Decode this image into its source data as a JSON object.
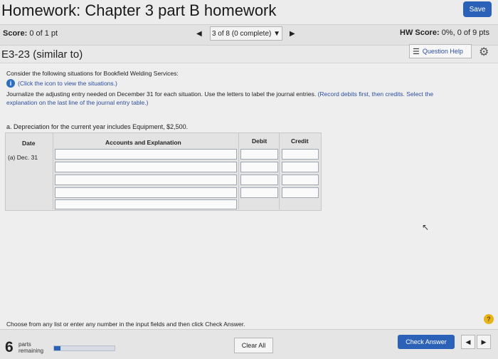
{
  "header": {
    "title": "Homework: Chapter 3 part B homework",
    "save_label": "Save"
  },
  "scorebar": {
    "score_label": "Score:",
    "score_value": "0 of 1 pt",
    "question_nav": "3 of 8 (0 complete)",
    "hw_score_label": "HW Score:",
    "hw_score_value": "0%, 0 of 9 pts"
  },
  "question": {
    "title": "E3-23 (similar to)",
    "help_label": "Question Help",
    "intro": "Consider the following situations for Bookfield Welding Services:",
    "info_link": "(Click the icon to view the situations.)",
    "instructions": "Journalize the adjusting entry needed on December 31 for each situation. Use the letters to label the journal entries.",
    "instructions_note_1": "(Record debits first, then credits. Select the",
    "instructions_note_2": "explanation on the last line of the journal entry table.)",
    "part_a": "a. Depreciation for the current year includes Equipment, $2,500."
  },
  "journal": {
    "headers": {
      "date": "Date",
      "accounts": "Accounts and Explanation",
      "debit": "Debit",
      "credit": "Credit"
    },
    "date_value": "(a) Dec. 31"
  },
  "footer": {
    "prompt": "Choose from any list or enter any number in the input fields and then click Check Answer.",
    "parts_count": "6",
    "parts_label_1": "parts",
    "parts_label_2": "remaining",
    "progress_fraction": 0.1,
    "clear_label": "Clear All",
    "check_label": "Check Answer"
  },
  "colors": {
    "accent": "#2b62b8",
    "help": "#e6b419"
  },
  "icons": [
    "info-icon",
    "list-icon",
    "gear-icon",
    "help-icon",
    "chevron-left-icon",
    "chevron-right-icon"
  ]
}
